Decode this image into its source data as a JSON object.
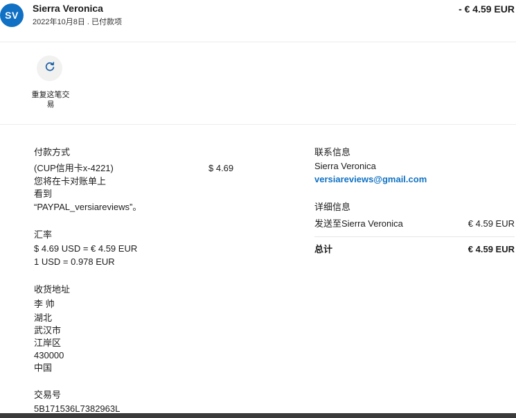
{
  "header": {
    "avatar_initials": "SV",
    "merchant_name": "Sierra Veronica",
    "date_status": "2022年10月8日 . 已付款项",
    "amount": "- € 4.59 EUR"
  },
  "actions": {
    "repeat_icon": "refresh-icon",
    "repeat_label": "重复这笔交易"
  },
  "payment": {
    "heading": "付款方式",
    "method": "(CUP信用卡x-4221)",
    "amount": "$ 4.69",
    "statement_note_line1": "您将在卡对账单上",
    "statement_note_line2": "看到",
    "statement_note_line3": "“PAYPAL_versiareviews”。"
  },
  "exchange": {
    "heading": "汇率",
    "line1": "$ 4.69 USD = € 4.59 EUR",
    "line2": "1 USD = 0.978 EUR"
  },
  "shipping": {
    "heading": "收货地址",
    "name": "李 帅",
    "province": "湖北",
    "city": "武汉市",
    "district": "江岸区",
    "postcode": "430000",
    "country": "中国"
  },
  "transaction": {
    "heading": "交易号",
    "id": "5B171536L7382963L"
  },
  "contact": {
    "heading": "联系信息",
    "name": "Sierra Veronica",
    "email": "versiareviews@gmail.com"
  },
  "details": {
    "heading": "详细信息",
    "sent_to_label": "发送至Sierra Veronica",
    "sent_to_amount": "€ 4.59 EUR",
    "total_label": "总计",
    "total_amount": "€ 4.59 EUR"
  },
  "colors": {
    "avatar": "#1071c4",
    "link": "#1072c4",
    "bottom_bar": "#3a3a3a"
  }
}
